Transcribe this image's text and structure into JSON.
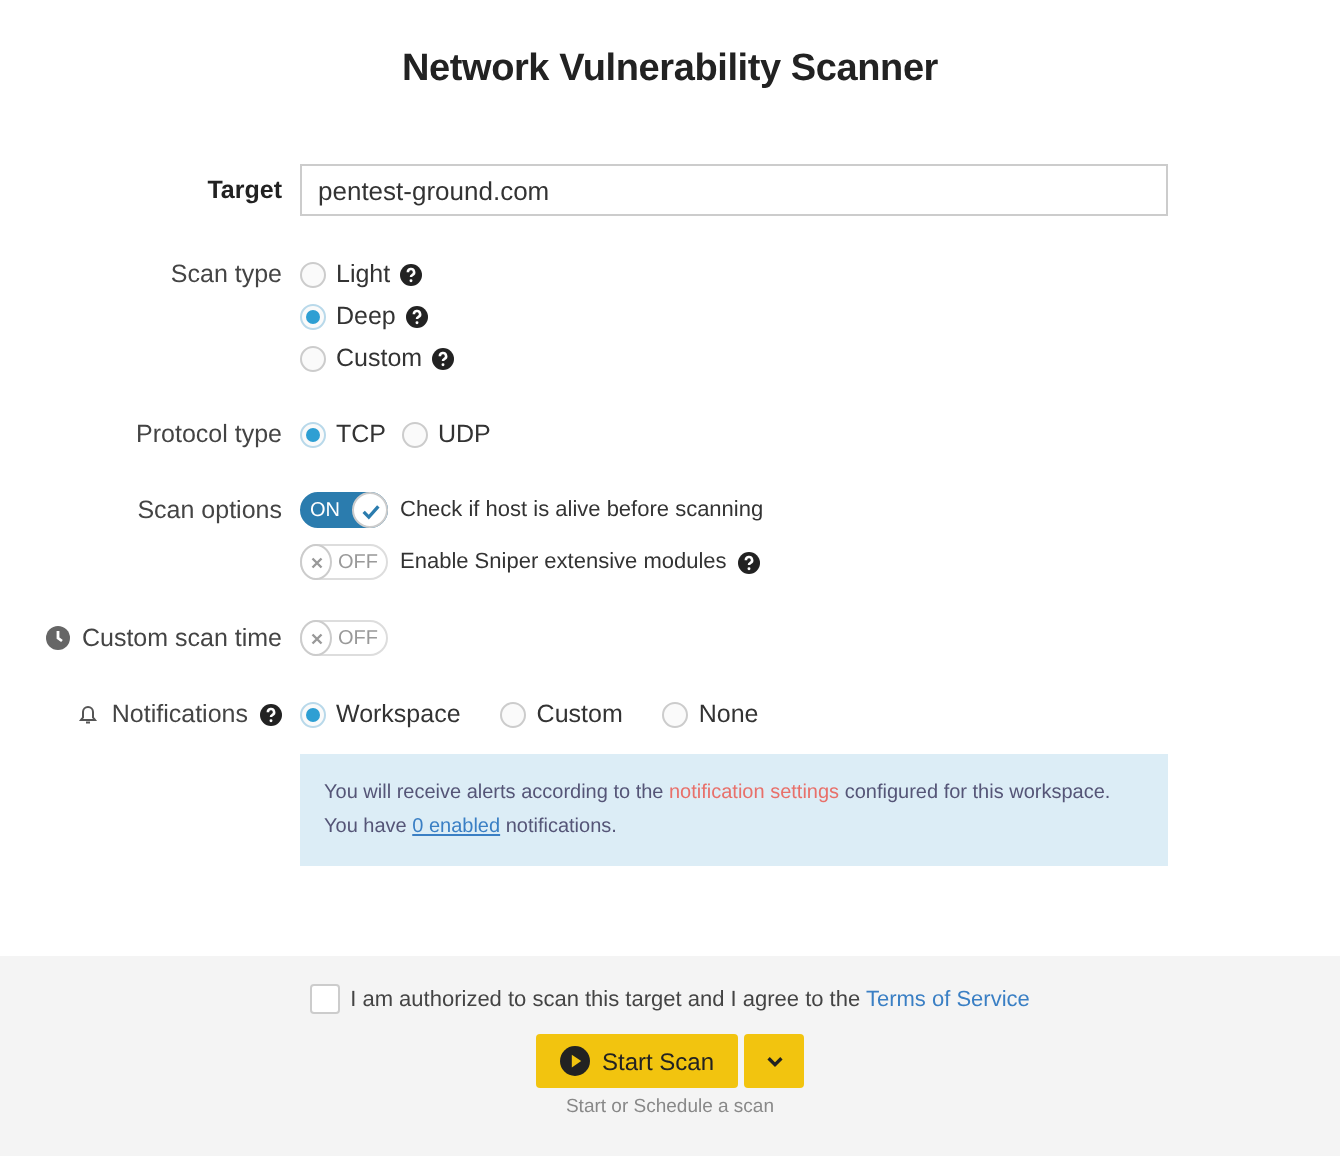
{
  "title": "Network Vulnerability Scanner",
  "target": {
    "label": "Target",
    "value": "pentest-ground.com"
  },
  "scan_type": {
    "label": "Scan type",
    "options": [
      {
        "label": "Light",
        "selected": false,
        "help": true
      },
      {
        "label": "Deep",
        "selected": true,
        "help": true
      },
      {
        "label": "Custom",
        "selected": false,
        "help": true
      }
    ]
  },
  "protocol_type": {
    "label": "Protocol type",
    "options": [
      {
        "label": "TCP",
        "selected": true
      },
      {
        "label": "UDP",
        "selected": false
      }
    ]
  },
  "scan_options": {
    "label": "Scan options",
    "items": [
      {
        "on": true,
        "state_label": "ON",
        "label": "Check if host is alive before scanning",
        "help": false
      },
      {
        "on": false,
        "state_label": "OFF",
        "label": "Enable Sniper extensive modules",
        "help": true
      }
    ]
  },
  "custom_scan_time": {
    "label": "Custom scan time",
    "on": false,
    "state_label": "OFF"
  },
  "notifications": {
    "label": "Notifications",
    "help": true,
    "options": [
      {
        "label": "Workspace",
        "selected": true
      },
      {
        "label": "Custom",
        "selected": false
      },
      {
        "label": "None",
        "selected": false
      }
    ],
    "info": {
      "line_1": {
        "before": "You will receive alerts according to the",
        "link": "notification settings",
        "after": "configured for this workspace."
      },
      "line_2": {
        "before": "You have",
        "link": "0 enabled",
        "after": "notifications."
      }
    }
  },
  "footer": {
    "agreement": {
      "checked": false,
      "text": "I am authorized to scan this target and I agree to the",
      "link": "Terms of Service"
    },
    "start_button": "Start Scan",
    "hint": "Start or Schedule a scan"
  }
}
